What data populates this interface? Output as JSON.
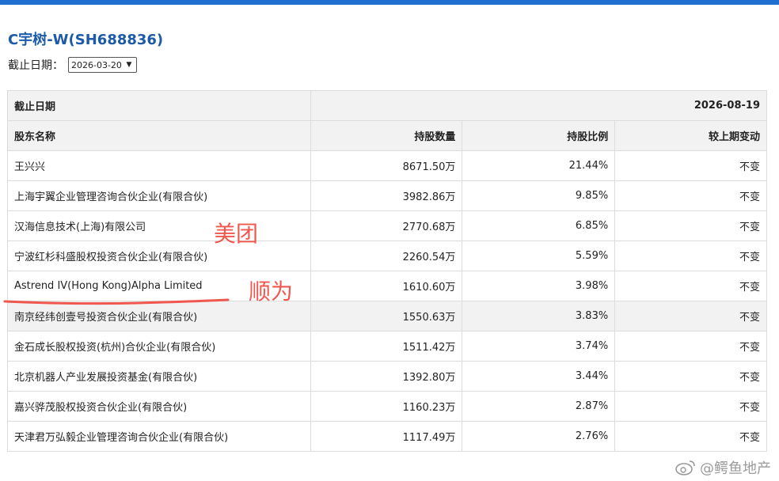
{
  "title": "C宇树-W(SH688836)",
  "date_filter": {
    "label": "截止日期：",
    "selected": "2026-03-20"
  },
  "table": {
    "header1": {
      "label": "截止日期",
      "value": "2026-08-19"
    },
    "columns": [
      "股东名称",
      "持股数量",
      "持股比例",
      "较上期变动"
    ],
    "rows": [
      [
        "王兴兴",
        "8671.50万",
        "21.44%",
        "不变"
      ],
      [
        "上海宇翼企业管理咨询合伙企业(有限合伙)",
        "3982.86万",
        "9.85%",
        "不变"
      ],
      [
        "汉海信息技术(上海)有限公司",
        "2770.68万",
        "6.85%",
        "不变"
      ],
      [
        "宁波红杉科盛股权投资合伙企业(有限合伙)",
        "2260.54万",
        "5.59%",
        "不变"
      ],
      [
        "Astrend IV(Hong Kong)Alpha Limited",
        "1610.60万",
        "3.98%",
        "不变"
      ],
      [
        "南京经纬创壹号投资合伙企业(有限合伙)",
        "1550.63万",
        "3.83%",
        "不变"
      ],
      [
        "金石成长股权投资(杭州)合伙企业(有限合伙)",
        "1511.42万",
        "3.74%",
        "不变"
      ],
      [
        "北京机器人产业发展投资基金(有限合伙)",
        "1392.80万",
        "3.44%",
        "不变"
      ],
      [
        "嘉兴骅茂股权投资合伙企业(有限合伙)",
        "1160.23万",
        "2.87%",
        "不变"
      ],
      [
        "天津君万弘毅企业管理咨询合伙企业(有限合伙)",
        "1117.49万",
        "2.76%",
        "不变"
      ]
    ]
  },
  "annotations": {
    "meituan": "美团",
    "shunwei": "顺为"
  },
  "watermark": "@鳄鱼地产",
  "colors": {
    "accent": "#1f6fd1",
    "title": "#1d5aa8",
    "annotation": "#f0574f"
  }
}
